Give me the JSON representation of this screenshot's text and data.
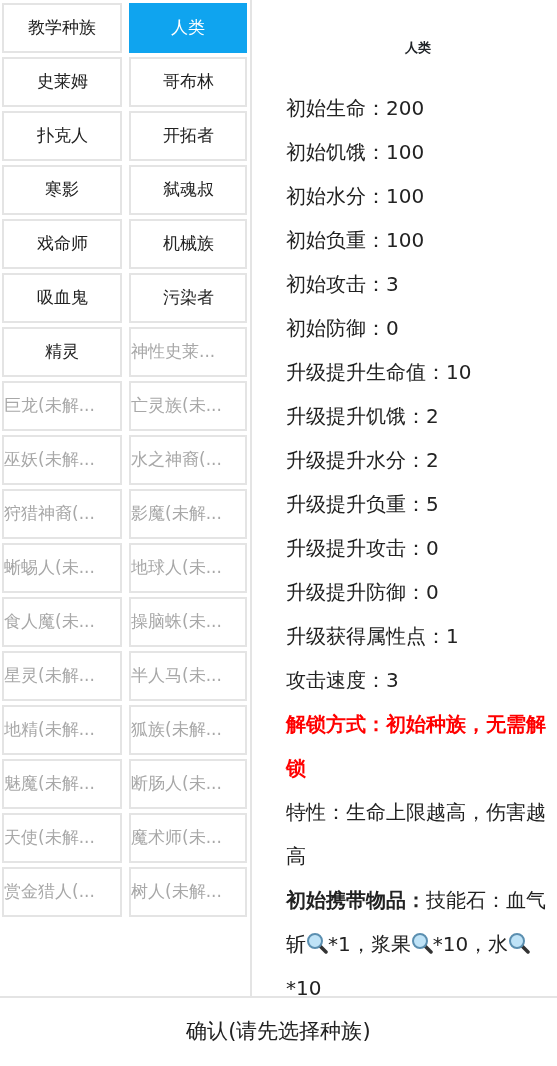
{
  "races": [
    {
      "label": "教学种族",
      "selected": false,
      "locked": false
    },
    {
      "label": "人类",
      "selected": true,
      "locked": false
    },
    {
      "label": "史莱姆",
      "selected": false,
      "locked": false
    },
    {
      "label": "哥布林",
      "selected": false,
      "locked": false
    },
    {
      "label": "扑克人",
      "selected": false,
      "locked": false
    },
    {
      "label": "开拓者",
      "selected": false,
      "locked": false
    },
    {
      "label": "寒影",
      "selected": false,
      "locked": false
    },
    {
      "label": "弑魂叔",
      "selected": false,
      "locked": false
    },
    {
      "label": "戏命师",
      "selected": false,
      "locked": false
    },
    {
      "label": "机械族",
      "selected": false,
      "locked": false
    },
    {
      "label": "吸血鬼",
      "selected": false,
      "locked": false
    },
    {
      "label": "污染者",
      "selected": false,
      "locked": false
    },
    {
      "label": "精灵",
      "selected": false,
      "locked": false
    },
    {
      "label": "神性史莱...",
      "selected": false,
      "locked": true
    },
    {
      "label": "巨龙(未解...",
      "selected": false,
      "locked": true
    },
    {
      "label": "亡灵族(未...",
      "selected": false,
      "locked": true
    },
    {
      "label": "巫妖(未解...",
      "selected": false,
      "locked": true
    },
    {
      "label": "水之神裔(...",
      "selected": false,
      "locked": true
    },
    {
      "label": "狩猎神裔(...",
      "selected": false,
      "locked": true
    },
    {
      "label": "影魔(未解...",
      "selected": false,
      "locked": true
    },
    {
      "label": "蜥蜴人(未...",
      "selected": false,
      "locked": true
    },
    {
      "label": "地球人(未...",
      "selected": false,
      "locked": true
    },
    {
      "label": "食人魔(未...",
      "selected": false,
      "locked": true
    },
    {
      "label": "操脑蛛(未...",
      "selected": false,
      "locked": true
    },
    {
      "label": "星灵(未解...",
      "selected": false,
      "locked": true
    },
    {
      "label": "半人马(未...",
      "selected": false,
      "locked": true
    },
    {
      "label": "地精(未解...",
      "selected": false,
      "locked": true
    },
    {
      "label": "狐族(未解...",
      "selected": false,
      "locked": true
    },
    {
      "label": "魅魔(未解...",
      "selected": false,
      "locked": true
    },
    {
      "label": "断肠人(未...",
      "selected": false,
      "locked": true
    },
    {
      "label": "天使(未解...",
      "selected": false,
      "locked": true
    },
    {
      "label": "魔术师(未...",
      "selected": false,
      "locked": true
    },
    {
      "label": "赏金猎人(...",
      "selected": false,
      "locked": true
    },
    {
      "label": "树人(未解...",
      "selected": false,
      "locked": true
    }
  ],
  "detail": {
    "title": "人类",
    "lines": [
      {
        "kind": "stat",
        "text": "初始生命：200"
      },
      {
        "kind": "stat",
        "text": "初始饥饿：100"
      },
      {
        "kind": "stat",
        "text": "初始水分：100"
      },
      {
        "kind": "stat",
        "text": "初始负重：100"
      },
      {
        "kind": "stat",
        "text": "初始攻击：3"
      },
      {
        "kind": "stat",
        "text": "初始防御：0"
      },
      {
        "kind": "stat",
        "text": "升级提升生命值：10"
      },
      {
        "kind": "stat",
        "text": "升级提升饥饿：2"
      },
      {
        "kind": "stat",
        "text": "升级提升水分：2"
      },
      {
        "kind": "stat",
        "text": "升级提升负重：5"
      },
      {
        "kind": "stat",
        "text": "升级提升攻击：0"
      },
      {
        "kind": "stat",
        "text": "升级提升防御：0"
      },
      {
        "kind": "stat",
        "text": "升级获得属性点：1"
      },
      {
        "kind": "stat",
        "text": "攻击速度：3"
      },
      {
        "kind": "unlock",
        "text": "解锁方式：初始种族，无需解锁"
      },
      {
        "kind": "stat",
        "text": "特性：生命上限越高，伤害越高"
      }
    ],
    "carry": {
      "label": "初始携带物品：",
      "intro": "技能石：",
      "items": [
        {
          "name": "血气斩",
          "count": "*1，"
        },
        {
          "name": "浆果",
          "count": "*10，"
        },
        {
          "name": "水",
          "count": "*10"
        }
      ]
    }
  },
  "confirm": "确认(请先选择种族)"
}
